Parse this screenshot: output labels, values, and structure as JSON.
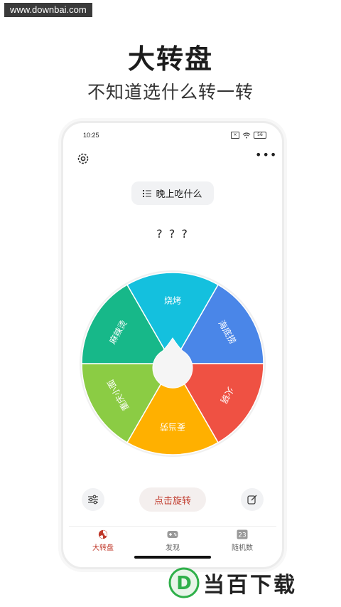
{
  "watermark": "www.downbai.com",
  "hero": {
    "title": "大转盘",
    "subtitle": "不知道选什么转一转"
  },
  "status_bar": {
    "time": "10:25",
    "battery": "56"
  },
  "list_selector": {
    "label": "晚上吃什么"
  },
  "result": "? ? ?",
  "wheel": {
    "segments": [
      {
        "label": "海底捞",
        "color": "#4a86e8"
      },
      {
        "label": "火锅",
        "color": "#ef5143"
      },
      {
        "label": "麦当劳",
        "color": "#ffb000"
      },
      {
        "label": "重庆小面",
        "color": "#8bcc44"
      },
      {
        "label": "麻辣烫",
        "color": "#17b889"
      },
      {
        "label": "烧烤",
        "color": "#14c0de"
      }
    ]
  },
  "controls": {
    "spin_label": "点击旋转"
  },
  "tabs": [
    {
      "label": "大转盘",
      "active": true
    },
    {
      "label": "发现",
      "active": false
    },
    {
      "label": "随机数",
      "active": false,
      "badge": "23"
    }
  ],
  "brand": {
    "name": "当百下载",
    "logo_letter": "D"
  },
  "colors": {
    "accent": "#c0392b",
    "brand_green": "#2fb04a"
  }
}
